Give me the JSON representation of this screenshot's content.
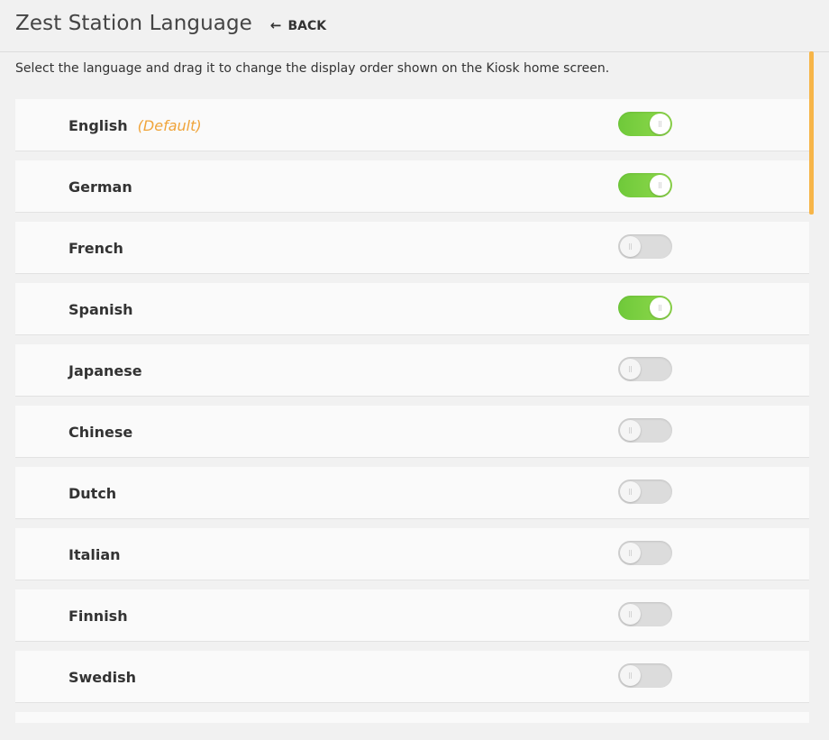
{
  "header": {
    "title": "Zest Station Language",
    "back_label": "BACK",
    "back_icon": "arrow-left-icon"
  },
  "instructions": "Select the language and drag it to change the display order shown on the Kiosk home screen.",
  "colors": {
    "accent": "#f0a43a",
    "toggle_on": "#7ccf40",
    "toggle_off": "#dcdcdc"
  },
  "languages": [
    {
      "name": "English",
      "tag": "(Default)",
      "enabled": true
    },
    {
      "name": "German",
      "tag": "",
      "enabled": true
    },
    {
      "name": "French",
      "tag": "",
      "enabled": false
    },
    {
      "name": "Spanish",
      "tag": "",
      "enabled": true
    },
    {
      "name": "Japanese",
      "tag": "",
      "enabled": false
    },
    {
      "name": "Chinese",
      "tag": "",
      "enabled": false
    },
    {
      "name": "Dutch",
      "tag": "",
      "enabled": false
    },
    {
      "name": "Italian",
      "tag": "",
      "enabled": false
    },
    {
      "name": "Finnish",
      "tag": "",
      "enabled": false
    },
    {
      "name": "Swedish",
      "tag": "",
      "enabled": false
    }
  ]
}
